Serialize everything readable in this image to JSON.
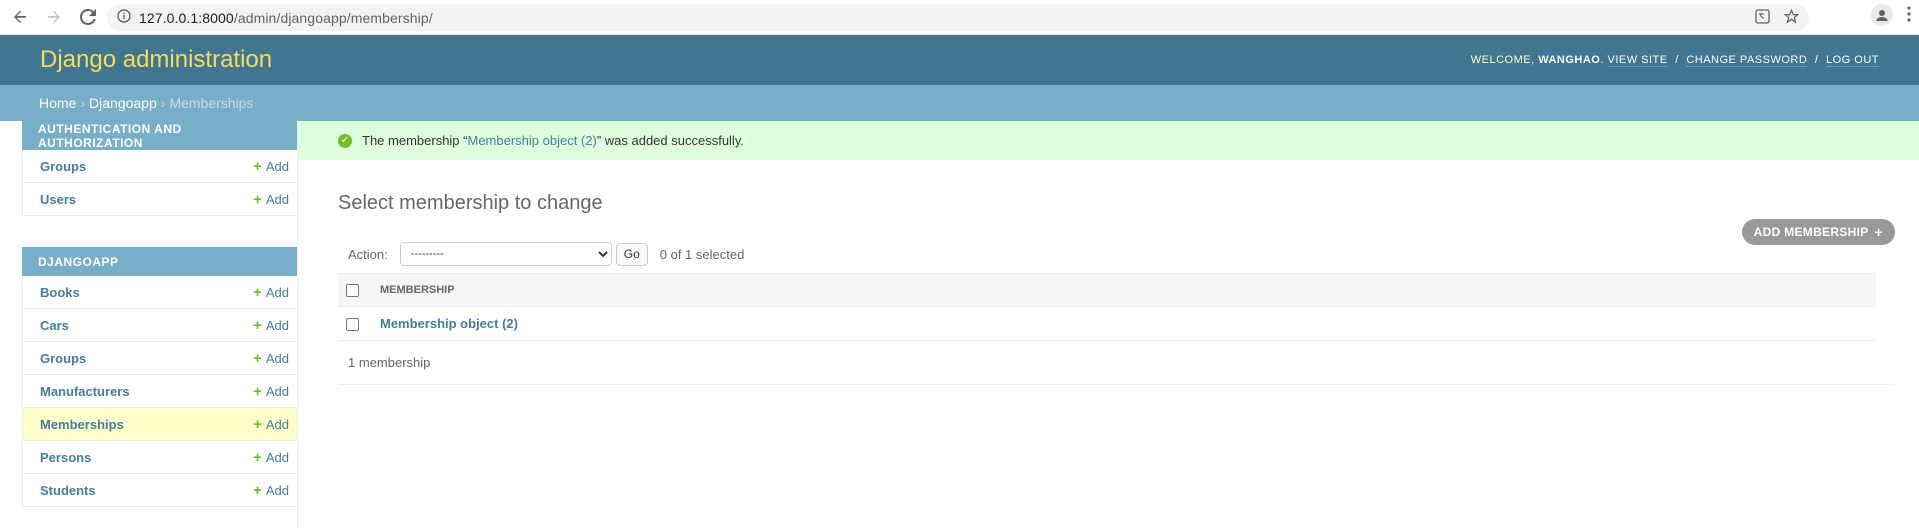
{
  "browser": {
    "url_host": "127.0.0.1:8000",
    "url_path": "/admin/djangoapp/membership/"
  },
  "header": {
    "brand": "Django administration",
    "welcome": "WELCOME,",
    "username": "WANGHAO",
    "view_site": "VIEW SITE",
    "change_password": "CHANGE PASSWORD",
    "log_out": "LOG OUT",
    "separator": "/"
  },
  "breadcrumbs": {
    "home": "Home",
    "app": "Djangoapp",
    "current": "Memberships",
    "arrow": "›"
  },
  "sidebar": {
    "auth_caption": "AUTHENTICATION AND AUTHORIZATION",
    "auth_items": [
      {
        "label": "Groups",
        "add": "Add"
      },
      {
        "label": "Users",
        "add": "Add"
      }
    ],
    "app_caption": "DJANGOAPP",
    "app_items": [
      {
        "label": "Books",
        "add": "Add"
      },
      {
        "label": "Cars",
        "add": "Add"
      },
      {
        "label": "Groups",
        "add": "Add"
      },
      {
        "label": "Manufacturers",
        "add": "Add"
      },
      {
        "label": "Memberships",
        "add": "Add"
      },
      {
        "label": "Persons",
        "add": "Add"
      },
      {
        "label": "Students",
        "add": "Add"
      }
    ]
  },
  "message": {
    "prefix": "The membership “",
    "link": "Membership object (2)",
    "suffix": "” was added successfully."
  },
  "main": {
    "title": "Select membership to change",
    "add_button": "ADD MEMBERSHIP",
    "action_label": "Action:",
    "action_selected": "---------",
    "go_button": "Go",
    "selected_count": "0 of 1 selected",
    "column_header": "MEMBERSHIP",
    "rows": [
      "Membership object (2)"
    ],
    "paginator": "1 membership"
  },
  "colors": {
    "header_bg": "#417690",
    "brand": "#f5dd5d",
    "breadcrumb_bg": "#79aec8",
    "link": "#447e9b",
    "success_bg": "#ddffdd",
    "add_green": "#70bf2b",
    "current_row_bg": "#ffffcc"
  }
}
